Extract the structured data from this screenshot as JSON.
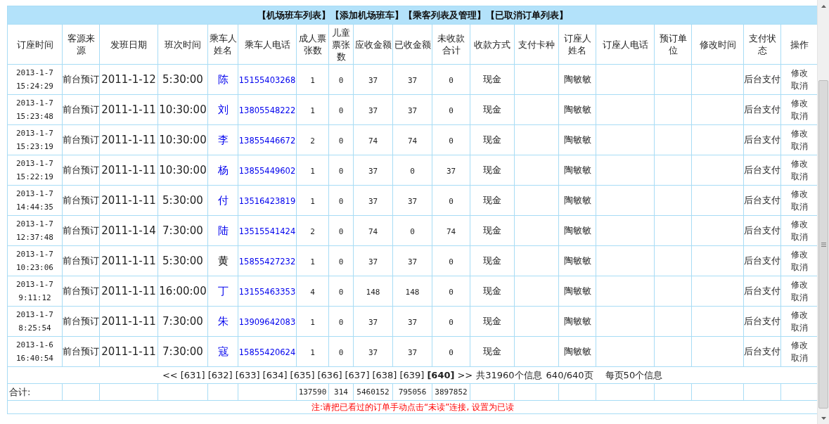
{
  "nav_links": [
    "【机场班车列表】",
    "【添加机场班车】",
    "【乘客列表及管理】",
    "【已取消订单列表】"
  ],
  "table": {
    "columns": [
      "订座时间",
      "客源来源",
      "发班日期",
      "班次时间",
      "乘车人姓名",
      "乘车人电话",
      "成人票张数",
      "儿童票张数",
      "应收金额",
      "已收金额",
      "未收款合计",
      "收款方式",
      "支付卡种",
      "订座人姓名",
      "订座人电话",
      "预订单位",
      "修改时间",
      "支付状态",
      "操作"
    ],
    "rows": [
      {
        "order_time": "2013-1-7 15:24:29",
        "source": "前台预订",
        "depart_date": "2011-1-12",
        "depart_time": "5:30:00",
        "passenger_name": "陈",
        "visited": false,
        "passenger_phone": "15155403268",
        "adult_tickets": "1",
        "child_tickets": "0",
        "amount_due": "37",
        "amount_paid": "37",
        "amount_unpaid": "0",
        "payment_method": "现金",
        "booker_name": "陶敏敏",
        "pay_status": "后台支付",
        "actions": [
          "修改",
          "取消"
        ]
      },
      {
        "order_time": "2013-1-7 15:23:48",
        "source": "前台预订",
        "depart_date": "2011-1-11",
        "depart_time": "10:30:00",
        "passenger_name": "刘",
        "visited": false,
        "passenger_phone": "13805548222",
        "adult_tickets": "1",
        "child_tickets": "0",
        "amount_due": "37",
        "amount_paid": "37",
        "amount_unpaid": "0",
        "payment_method": "现金",
        "booker_name": "陶敏敏",
        "pay_status": "后台支付",
        "actions": [
          "修改",
          "取消"
        ]
      },
      {
        "order_time": "2013-1-7 15:23:19",
        "source": "前台预订",
        "depart_date": "2011-1-11",
        "depart_time": "10:30:00",
        "passenger_name": "李",
        "visited": false,
        "passenger_phone": "13855446672",
        "adult_tickets": "2",
        "child_tickets": "0",
        "amount_due": "74",
        "amount_paid": "74",
        "amount_unpaid": "0",
        "payment_method": "现金",
        "booker_name": "陶敏敏",
        "pay_status": "后台支付",
        "actions": [
          "修改",
          "取消"
        ]
      },
      {
        "order_time": "2013-1-7 15:22:19",
        "source": "前台预订",
        "depart_date": "2011-1-11",
        "depart_time": "10:30:00",
        "passenger_name": "杨",
        "visited": false,
        "passenger_phone": "13855449602",
        "adult_tickets": "1",
        "child_tickets": "0",
        "amount_due": "37",
        "amount_paid": "0",
        "amount_unpaid": "37",
        "payment_method": "现金",
        "booker_name": "陶敏敏",
        "pay_status": "后台支付",
        "actions": [
          "修改",
          "取消"
        ]
      },
      {
        "order_time": "2013-1-7 14:44:35",
        "source": "前台预订",
        "depart_date": "2011-1-11",
        "depart_time": "5:30:00",
        "passenger_name": "付",
        "visited": false,
        "passenger_phone": "13516423819",
        "adult_tickets": "1",
        "child_tickets": "0",
        "amount_due": "37",
        "amount_paid": "37",
        "amount_unpaid": "0",
        "payment_method": "现金",
        "booker_name": "陶敏敏",
        "pay_status": "后台支付",
        "actions": [
          "修改",
          "取消"
        ]
      },
      {
        "order_time": "2013-1-7 12:37:48",
        "source": "前台预订",
        "depart_date": "2011-1-14",
        "depart_time": "7:30:00",
        "passenger_name": "陆",
        "visited": false,
        "passenger_phone": "13515541424",
        "adult_tickets": "2",
        "child_tickets": "0",
        "amount_due": "74",
        "amount_paid": "0",
        "amount_unpaid": "74",
        "payment_method": "现金",
        "booker_name": "陶敏敏",
        "pay_status": "后台支付",
        "actions": [
          "修改",
          "取消"
        ]
      },
      {
        "order_time": "2013-1-7 10:23:06",
        "source": "前台预订",
        "depart_date": "2011-1-11",
        "depart_time": "5:30:00",
        "passenger_name": "黄",
        "visited": true,
        "passenger_phone": "15855427232",
        "adult_tickets": "1",
        "child_tickets": "0",
        "amount_due": "37",
        "amount_paid": "37",
        "amount_unpaid": "0",
        "payment_method": "现金",
        "booker_name": "陶敏敏",
        "pay_status": "后台支付",
        "actions": [
          "修改",
          "取消"
        ]
      },
      {
        "order_time": "2013-1-7 9:11:12",
        "source": "前台预订",
        "depart_date": "2011-1-11",
        "depart_time": "16:00:00",
        "passenger_name": "丁",
        "visited": false,
        "passenger_phone": "13155463353",
        "adult_tickets": "4",
        "child_tickets": "0",
        "amount_due": "148",
        "amount_paid": "148",
        "amount_unpaid": "0",
        "payment_method": "现金",
        "booker_name": "陶敏敏",
        "pay_status": "后台支付",
        "actions": [
          "修改",
          "取消"
        ]
      },
      {
        "order_time": "2013-1-7 8:25:54",
        "source": "前台预订",
        "depart_date": "2011-1-11",
        "depart_time": "7:30:00",
        "passenger_name": "朱",
        "visited": false,
        "passenger_phone": "13909642083",
        "adult_tickets": "1",
        "child_tickets": "0",
        "amount_due": "37",
        "amount_paid": "37",
        "amount_unpaid": "0",
        "payment_method": "现金",
        "booker_name": "陶敏敏",
        "pay_status": "后台支付",
        "actions": [
          "修改",
          "取消"
        ]
      },
      {
        "order_time": "2013-1-6 16:40:54",
        "source": "前台预订",
        "depart_date": "2011-1-11",
        "depart_time": "7:30:00",
        "passenger_name": "寇",
        "visited": false,
        "passenger_phone": "15855420624",
        "adult_tickets": "1",
        "child_tickets": "0",
        "amount_due": "37",
        "amount_paid": "37",
        "amount_unpaid": "0",
        "payment_method": "现金",
        "booker_name": "陶敏敏",
        "pay_status": "后台支付",
        "actions": [
          "修改",
          "取消"
        ]
      }
    ]
  },
  "pager": {
    "prev": "<<",
    "pages": [
      {
        "label": "[631]",
        "selected": false
      },
      {
        "label": "[632]",
        "selected": false
      },
      {
        "label": "[633]",
        "selected": false
      },
      {
        "label": "[634]",
        "selected": false
      },
      {
        "label": "[635]",
        "selected": false
      },
      {
        "label": "[636]",
        "selected": false
      },
      {
        "label": "[637]",
        "selected": false
      },
      {
        "label": "[638]",
        "selected": false
      },
      {
        "label": "[639]",
        "selected": false
      },
      {
        "label": "[640]",
        "selected": true
      }
    ],
    "next": ">>",
    "total": "共31960个信息",
    "page_of": "640/640页",
    "per_page": "每页50个信息"
  },
  "totals": {
    "label": "合计:",
    "adult_tickets": "137590",
    "child_tickets": "314",
    "amount_due": "5460152",
    "amount_paid": "795056",
    "amount_unpaid": "3897852"
  },
  "note": "注:请把已看过的订单手动点击“未读”连接, 设置为已读"
}
